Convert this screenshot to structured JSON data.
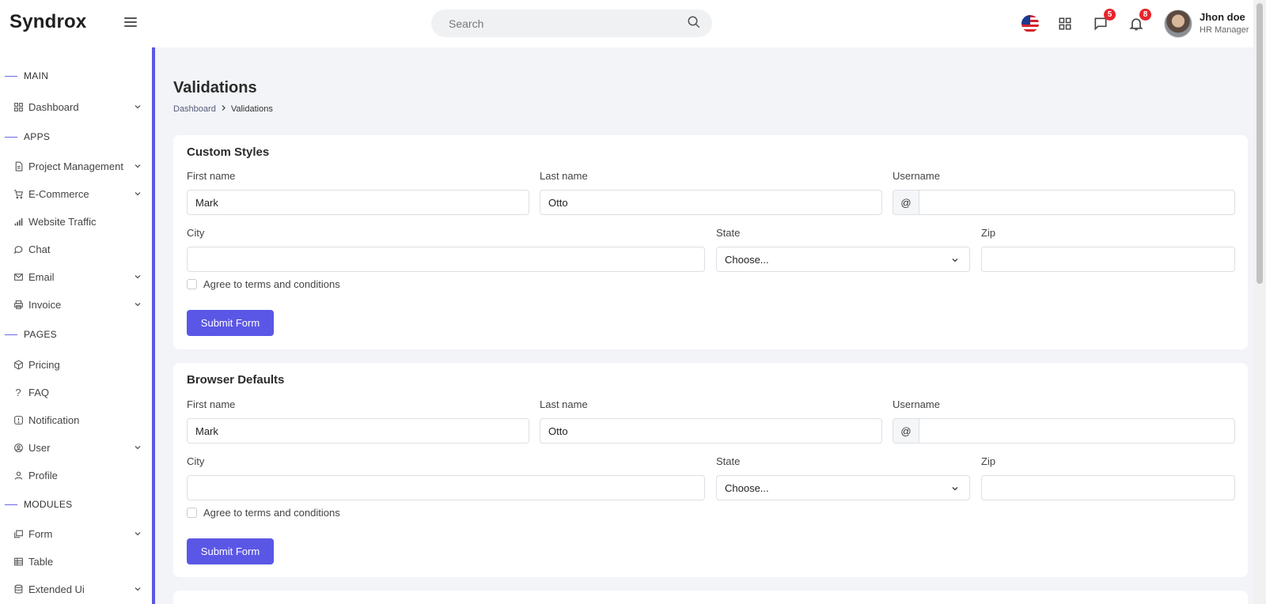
{
  "app": {
    "logo": "Syndrox"
  },
  "header": {
    "search_placeholder": "Search",
    "messages_badge": "5",
    "notifications_badge": "8",
    "user_name": "Jhon doe",
    "user_role": "HR Manager"
  },
  "sidebar": {
    "sections": {
      "main": "MAIN",
      "apps": "APPS",
      "pages": "PAGES",
      "modules": "MODULES"
    },
    "items": {
      "dashboard": "Dashboard",
      "project_management": "Project Management",
      "ecommerce": "E-Commerce",
      "website_traffic": "Website Traffic",
      "chat": "Chat",
      "email": "Email",
      "invoice": "Invoice",
      "pricing": "Pricing",
      "faq": "FAQ",
      "notification": "Notification",
      "user": "User",
      "profile": "Profile",
      "form": "Form",
      "table": "Table",
      "extended_ui": "Extended Ui"
    }
  },
  "page": {
    "title": "Validations",
    "breadcrumb_home": "Dashboard",
    "breadcrumb_current": "Validations"
  },
  "forms": [
    {
      "title": "Custom Styles",
      "first_name_label": "First name",
      "first_name_value": "Mark",
      "last_name_label": "Last name",
      "last_name_value": "Otto",
      "username_label": "Username",
      "username_prefix": "@",
      "username_value": "",
      "city_label": "City",
      "city_value": "",
      "state_label": "State",
      "state_value": "Choose...",
      "zip_label": "Zip",
      "zip_value": "",
      "terms_label": "Agree to terms and conditions",
      "submit_label": "Submit Form"
    },
    {
      "title": "Browser Defaults",
      "first_name_label": "First name",
      "first_name_value": "Mark",
      "last_name_label": "Last name",
      "last_name_value": "Otto",
      "username_label": "Username",
      "username_prefix": "@",
      "username_value": "",
      "city_label": "City",
      "city_value": "",
      "state_label": "State",
      "state_value": "Choose...",
      "zip_label": "Zip",
      "zip_value": "",
      "terms_label": "Agree to terms and conditions",
      "submit_label": "Submit Form"
    }
  ],
  "theme": {
    "accent": "#5b57e6",
    "badge": "#e8242b"
  }
}
